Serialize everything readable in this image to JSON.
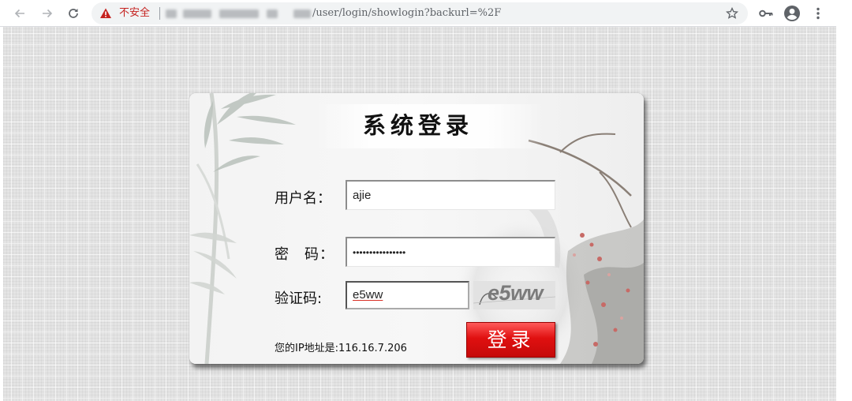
{
  "browser": {
    "security_label": "不安全",
    "url_path": "/user/login/showlogin?backurl=%2F",
    "icons": {
      "back": "arrow-left-icon",
      "forward": "arrow-right-icon",
      "reload": "reload-icon",
      "warning": "warning-triangle-icon",
      "bookmark": "star-icon",
      "passwords": "key-icon",
      "account": "account-circle-icon",
      "menu": "kebab-menu-icon"
    }
  },
  "login": {
    "title": "系统登录",
    "username_label": "用户名：",
    "username_value": "ajie",
    "password_label": "密　码：",
    "password_value": "••••••••••••••••",
    "captcha_label": "验证码:",
    "captcha_value": "e5ww",
    "captcha_image_text": "e5ww",
    "ip_text": "您的IP地址是:116.16.7.206",
    "submit_label": "登录"
  },
  "colors": {
    "warning": "#c5221f",
    "button": "#e01010",
    "background": "#e4e4e4"
  }
}
